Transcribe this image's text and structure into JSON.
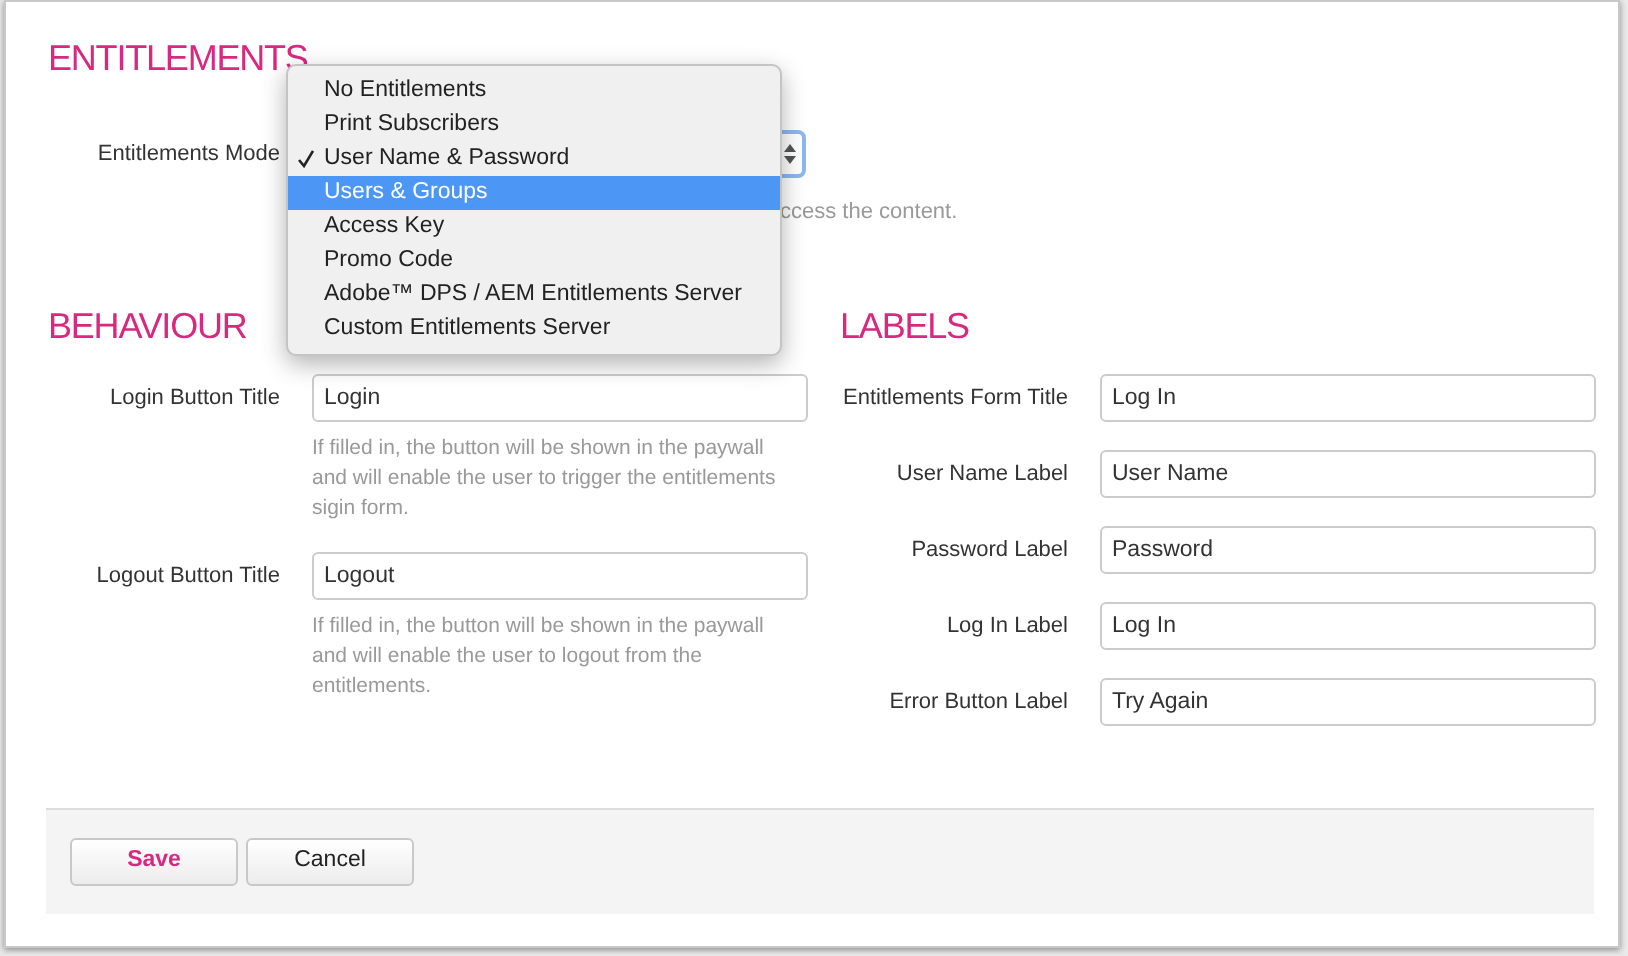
{
  "entitlements": {
    "heading": "ENTITLEMENTS",
    "mode_label": "Entitlements Mode",
    "hint": "ccess the content.",
    "menu": {
      "items": [
        {
          "label": "No Entitlements",
          "checked": false,
          "selected": false
        },
        {
          "label": "Print Subscribers",
          "checked": false,
          "selected": false
        },
        {
          "label": "User Name & Password",
          "checked": true,
          "selected": false
        },
        {
          "label": "Users & Groups",
          "checked": false,
          "selected": true
        },
        {
          "label": "Access Key",
          "checked": false,
          "selected": false
        },
        {
          "label": "Promo Code",
          "checked": false,
          "selected": false
        },
        {
          "label": "Adobe™ DPS / AEM Entitlements Server",
          "checked": false,
          "selected": false
        },
        {
          "label": "Custom Entitlements Server",
          "checked": false,
          "selected": false
        }
      ]
    }
  },
  "behaviour": {
    "heading": "BEHAVIOUR",
    "fields": [
      {
        "label": "Login Button Title",
        "value": "Login",
        "hint": "If filled in, the button will be shown in the paywall and will enable the user to trigger the entitlements sigin form."
      },
      {
        "label": "Logout Button Title",
        "value": "Logout",
        "hint": "If filled in, the button will be shown in the paywall and will enable the user to logout from the entitlements."
      }
    ]
  },
  "labels": {
    "heading": "LABELS",
    "fields": [
      {
        "label": "Entitlements Form Title",
        "value": "Log In"
      },
      {
        "label": "User Name Label",
        "value": "User Name"
      },
      {
        "label": "Password Label",
        "value": "Password"
      },
      {
        "label": "Log In Label",
        "value": "Log In"
      },
      {
        "label": "Error Button Label",
        "value": "Try Again"
      }
    ]
  },
  "buttons": [
    {
      "label": "Save",
      "kind": "primary"
    },
    {
      "label": "Cancel",
      "kind": "default"
    }
  ]
}
